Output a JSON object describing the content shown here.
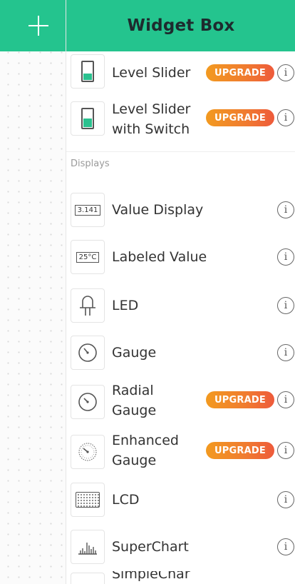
{
  "header": {
    "title": "Widget Box",
    "add_icon": "plus-icon",
    "background_color": "#24c48e"
  },
  "sections": {
    "displays_label": "Displays"
  },
  "badge_text": "UPGRADE",
  "info_symbol": "i",
  "accent_color": "#24c48e",
  "badge_color": "#f07a30",
  "widgets": [
    {
      "label": "Level Slider",
      "icon": "level-slider-icon",
      "upgrade": true
    },
    {
      "label_line1": "Level Slider",
      "label_line2": "with Switch",
      "icon": "level-slider-switch-icon",
      "upgrade": true
    },
    {
      "label": "Value Display",
      "icon_text": "3.141",
      "icon": "value-display-icon",
      "upgrade": false
    },
    {
      "label": "Labeled Value",
      "icon_text": "25°C",
      "icon": "labeled-value-icon",
      "upgrade": false
    },
    {
      "label": "LED",
      "icon": "led-icon",
      "upgrade": false
    },
    {
      "label": "Gauge",
      "icon": "gauge-icon",
      "upgrade": false
    },
    {
      "label_line1": "Radial",
      "label_line2": "Gauge",
      "icon": "radial-gauge-icon",
      "upgrade": true
    },
    {
      "label_line1": "Enhanced",
      "label_line2": "Gauge",
      "icon": "enhanced-gauge-icon",
      "upgrade": true
    },
    {
      "label": "LCD",
      "icon": "lcd-icon",
      "upgrade": false
    },
    {
      "label": "SuperChart",
      "icon": "superchart-icon",
      "upgrade": false
    },
    {
      "label": "SimpleChar",
      "icon": "simplechart-icon",
      "upgrade": false
    }
  ]
}
